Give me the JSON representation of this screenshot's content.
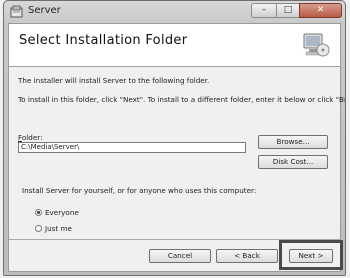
{
  "window": {
    "title": "Server"
  },
  "header": {
    "title": "Select Installation Folder"
  },
  "body": {
    "intro": "The installer will install Server to the following folder.",
    "instructions": "To install in this folder, click \"Next\". To install to a different folder, enter it below or click \"Browse\".",
    "folder_label_access": "F",
    "folder_label_rest": "older:",
    "folder_value": "C:\\Media\\Server\\",
    "browse_label": "Browse...",
    "disk_cost_label": "Disk Cost...",
    "scope_prompt": "Install Server for yourself, or for anyone who uses this computer:",
    "options": [
      {
        "label": "Everyone",
        "selected": true
      },
      {
        "label": "Just me",
        "selected": false
      }
    ]
  },
  "footer": {
    "cancel_label": "Cancel",
    "back_label": "< Back",
    "next_label": "Next >"
  }
}
